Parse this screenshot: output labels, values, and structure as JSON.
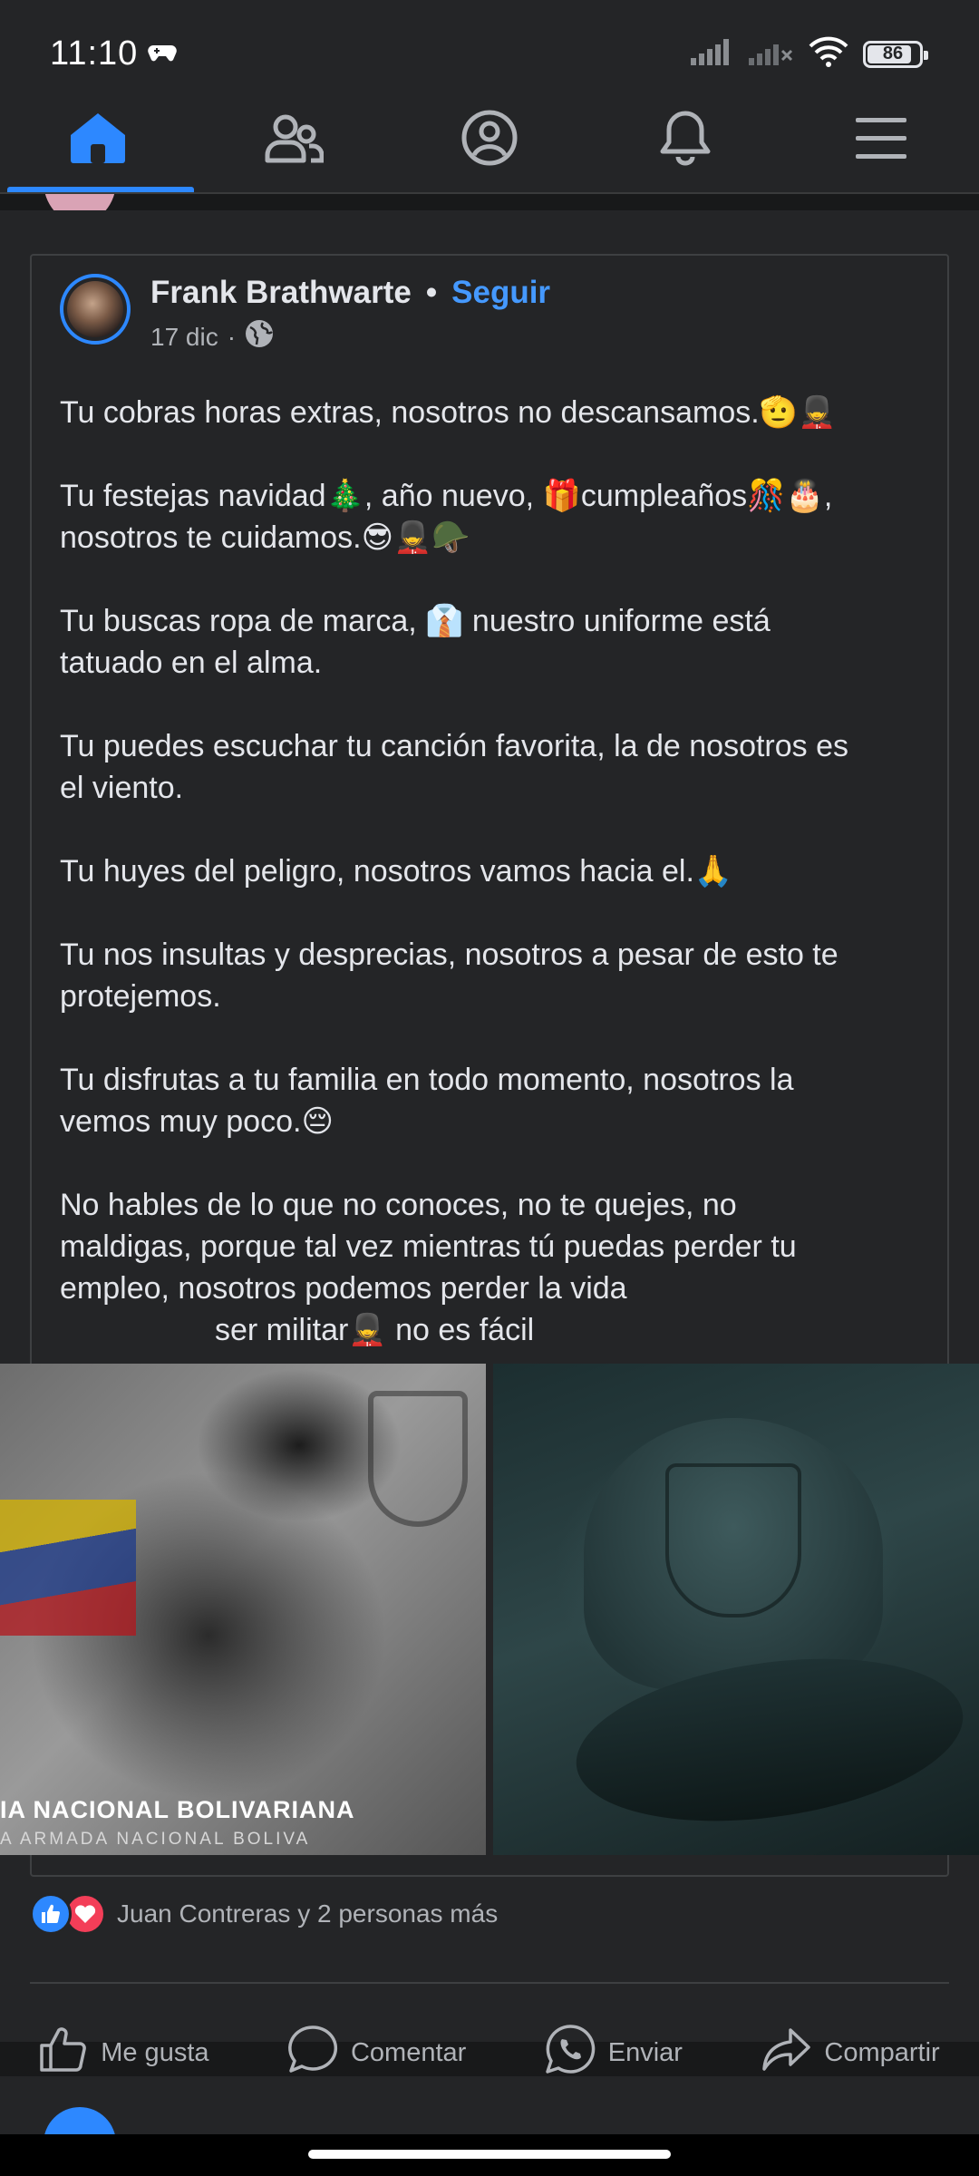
{
  "status_bar": {
    "time": "11:10",
    "battery_percent": "86",
    "battery_level": 0.86,
    "icons": [
      "gamepad-icon",
      "signal-icon",
      "signal-no-service-icon",
      "wifi-icon",
      "battery-icon"
    ]
  },
  "nav": {
    "tabs": [
      {
        "name": "home",
        "icon": "home-icon",
        "active": true
      },
      {
        "name": "friends",
        "icon": "friends-icon",
        "active": false
      },
      {
        "name": "profile",
        "icon": "profile-icon",
        "active": false
      },
      {
        "name": "notifications",
        "icon": "bell-icon",
        "active": false
      },
      {
        "name": "menu",
        "icon": "hamburger-menu-icon",
        "active": false
      }
    ],
    "accent_color": "#2d88ff"
  },
  "post": {
    "author": "Frank Brathwarte",
    "separator": "•",
    "follow_label": "Seguir",
    "date": "17 dic",
    "date_separator": "·",
    "privacy_icon": "globe-icon",
    "paragraphs": [
      "Tu cobras horas extras, nosotros no descansamos.🫡💂",
      "Tu festejas navidad🎄, año nuevo, 🎁cumpleaños🎊🎂,\nnosotros te cuidamos.😎💂🪖",
      "Tu buscas ropa de marca, 👔 nuestro uniforme está\ntatuado en el alma.",
      "Tu puedes escuchar tu canción favorita, la de nosotros es\nel viento.",
      "Tu huyes del peligro, nosotros vamos hacia el.🙏",
      "Tu nos insultas y desprecias, nosotros a pesar de esto te\nprotejemos.",
      "Tu disfrutas a tu familia en todo momento, nosotros la\nvemos muy poco.😔",
      "No hables de lo que no conoces, no te quejes, no\nmaldigas, porque tal vez mientras tú puedas perder tu\nempleo, nosotros podemos perder la vida"
    ],
    "closing_line": "ser militar💂 no es fácil",
    "images": {
      "left_caption_top": "IA NACIONAL  BOLIVARIANA",
      "left_caption_bottom": "A ARMADA NACIONAL BOLIVA"
    },
    "reactions": {
      "icons": [
        "like-icon",
        "love-icon"
      ],
      "text": "Juan Contreras y 2 personas más"
    },
    "actions": [
      {
        "label": "Me gusta",
        "icon": "thumbs-up-icon"
      },
      {
        "label": "Comentar",
        "icon": "comment-icon"
      },
      {
        "label": "Enviar",
        "icon": "whatsapp-icon"
      },
      {
        "label": "Compartir",
        "icon": "share-icon"
      }
    ]
  }
}
